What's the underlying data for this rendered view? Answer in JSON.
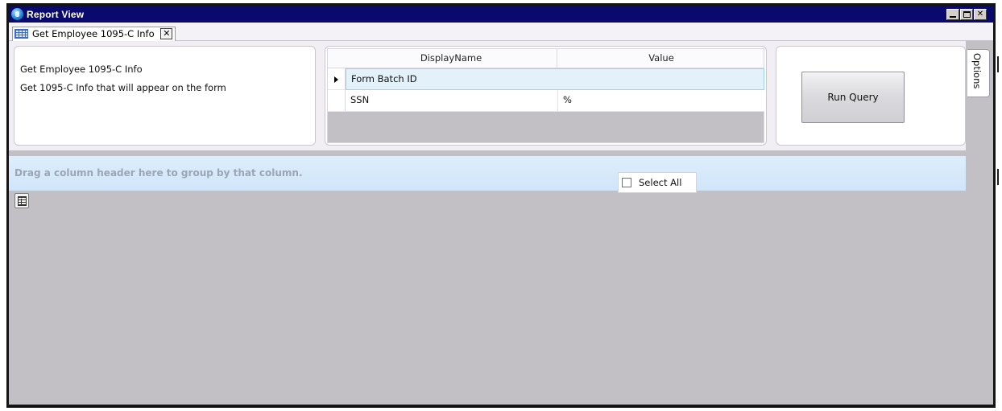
{
  "window": {
    "title": "Report View",
    "controls": {
      "minimize": "minimize",
      "maximize": "maximize",
      "close": "✕"
    }
  },
  "tab": {
    "label": "Get Employee 1095-C Info",
    "close_label": "✕"
  },
  "description": {
    "title": "Get Employee 1095-C Info",
    "text": "Get 1095-C Info that will appear on the form"
  },
  "params_grid": {
    "columns": [
      "DisplayName",
      "Value"
    ],
    "rows": [
      {
        "name": "Form Batch ID",
        "value": ""
      },
      {
        "name": "SSN",
        "value": "%"
      }
    ]
  },
  "actions": {
    "run_query": "Run Query"
  },
  "results": {
    "group_hint": "Drag a column header here to group by that column.",
    "select_all_label": "Select All",
    "select_all_checked": false
  },
  "side_panel": {
    "options_label": "Options"
  },
  "colors": {
    "titlebar": "#0a0a6e",
    "panel_bg": "#c2c0c4",
    "group_bar": "#cfe6fa",
    "selected_row": "#e3f1fb"
  },
  "icons": {
    "app": "app-globe-icon",
    "tab": "grid-icon",
    "column_chooser": "column-chooser-icon"
  }
}
